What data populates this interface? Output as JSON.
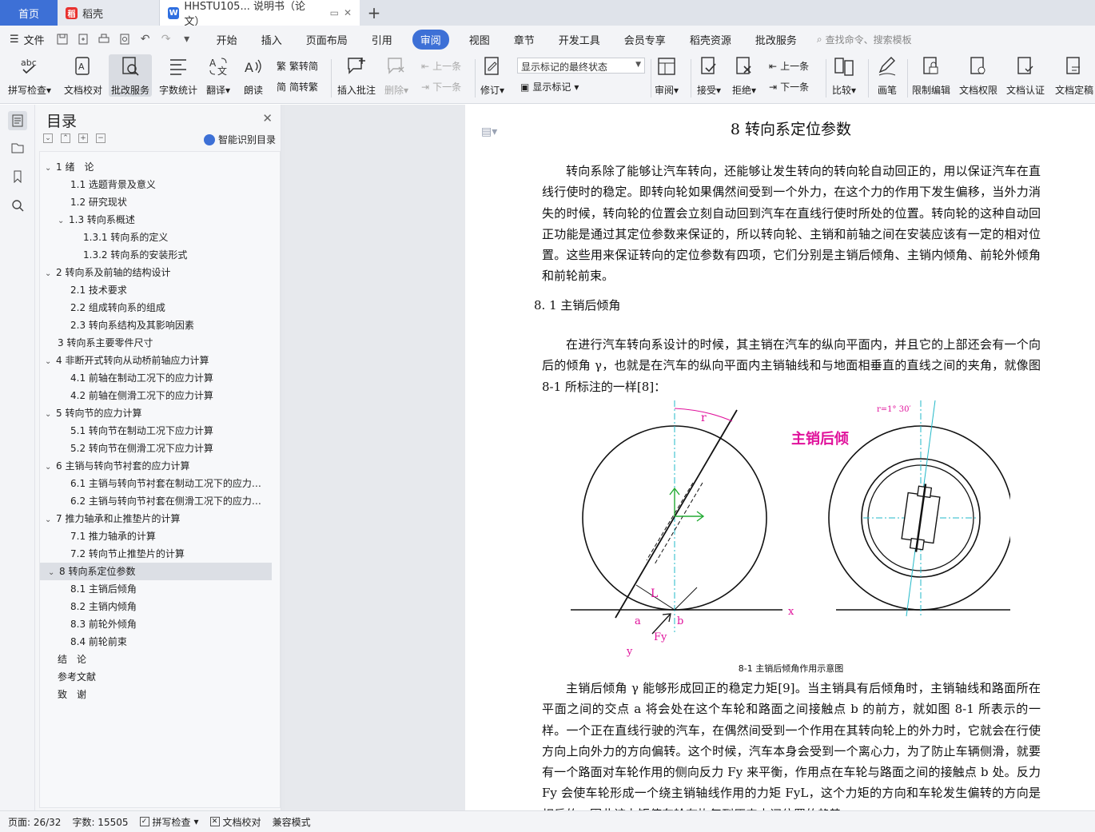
{
  "tabs": {
    "home": "首页",
    "docer": "稻壳",
    "doc": "HHSTU105... 说明书（论文）"
  },
  "menu": {
    "file": "文件",
    "tabs": [
      "开始",
      "插入",
      "页面布局",
      "引用",
      "审阅",
      "视图",
      "章节",
      "开发工具",
      "会员专享",
      "稻壳资源",
      "批改服务"
    ],
    "active_tab": "审阅",
    "search": "查找命令、搜索模板"
  },
  "toolbar": {
    "spellcheck": "拼写检查",
    "doccheck": "文档校对",
    "review_service": "批改服务",
    "wordcount": "字数统计",
    "translate": "翻译",
    "readaloud": "朗读",
    "trad": "繁转简",
    "simp": "简转繁",
    "insert_comment": "插入批注",
    "delete": "删除",
    "prev_comment": "上一条",
    "next_comment": "下一条",
    "revise": "修订",
    "markup_mode": "显示标记的最终状态",
    "show_markup": "显示标记",
    "review_pane": "审阅",
    "accept": "接受",
    "reject": "拒绝",
    "prev_change": "上一条",
    "next_change": "下一条",
    "compare": "比较",
    "pen": "画笔",
    "restrict": "限制编辑",
    "doc_permission": "文档权限",
    "doc_cert": "文档认证",
    "doc_final": "文档定稿"
  },
  "toc": {
    "title": "目录",
    "smart": "智能识别目录",
    "items": [
      "1 绪　论",
      "1.1 选题背景及意义",
      "1.2 研究现状",
      "1.3 转向系概述",
      "1.3.1 转向系的定义",
      "1.3.2 转向系的安装形式",
      "2  转向系及前轴的结构设计",
      "2.1  技术要求",
      "2.2  组成转向系的组成",
      "2.3  转向系结构及其影响因素",
      "3  转向系主要零件尺寸",
      "4 非断开式转向从动桥前轴应力计算",
      "4.1 前轴在制动工况下的应力计算",
      "4.2 前轴在侧滑工况下的应力计算",
      "5  转向节的应力计算",
      "5.1 转向节在制动工况下应力计算",
      "5.2  转向节在侧滑工况下应力计算",
      "6 主销与转向节衬套的应力计算",
      "6.1 主销与转向节衬套在制动工况下的应力…",
      "6.2 主销与转向节衬套在侧滑工况下的应力…",
      "7  推力轴承和止推垫片的计算",
      "7.1 推力轴承的计算",
      "7.2  转向节止推垫片的计算",
      "8 转向系定位参数",
      "8.1  主销后倾角",
      "8.2  主销内倾角",
      "8.3  前轮外倾角",
      "8.4  前轮前束",
      "结　论",
      "参考文献",
      "致　谢"
    ],
    "selected": 23
  },
  "doc": {
    "heading": "8  转向系定位参数",
    "p1": "转向系除了能够让汽车转向，还能够让发生转向的转向轮自动回正的，用以保证汽车在直线行使时的稳定。即转向轮如果偶然间受到一个外力，在这个力的作用下发生偏移，当外力消失的时候，转向轮的位置会立刻自动回到汽车在直线行使时所处的位置。转向轮的这种自动回正功能是通过其定位参数来保证的，所以转向轮、主销和前轴之间在安装应该有一定的相对位置。这些用来保证转向的定位参数有四项，它们分别是主销后倾角、主销内倾角、前轮外倾角和前轮前束。",
    "sub_heading": "8. 1    主销后倾角",
    "p2": "在进行汽车转向系设计的时候，其主销在汽车的纵向平面内，并且它的上部还会有一个向后的倾角 γ，也就是在汽车的纵向平面内主销轴线和与地面相垂直的直线之间的夹角，就像图 8-1 所标注的一样[8]：",
    "figure_labels": {
      "r": "r",
      "L": "L",
      "a": "a",
      "b": "b",
      "x": "x",
      "Fy": "Fy",
      "y": "y",
      "angle": "r=1° 30′",
      "title": "主销后倾"
    },
    "caption": "8-1  主销后倾角作用示意图",
    "p3": "主销后倾角 γ 能够形成回正的稳定力矩[9]。当主销具有后倾角时，主销轴线和路面所在平面之间的交点 a 将会处在这个车轮和路面之间接触点 b 的前方，就如图 8-1 所表示的一样。一个正在直线行驶的汽车，在偶然间受到一个作用在其转向轮上的外力时，它就会在行使方向上向外力的方向偏转。这个时候，汽车本身会受到一个离心力，为了防止车辆侧滑，就要有一个路面对车轮作用的侧向反力 Fy 来平衡，作用点在车轮与路面之间的接触点 b 处。反力 Fy 会使车轮形成一个绕主销轴线作用的力矩 FyL，这个力矩的方向和车轮发生偏转的方向是相反的，因此该力矩使车轮有恢复到原来中间位置的趋势。"
  },
  "status": {
    "page": "页面: 26/32",
    "words": "字数: 15505",
    "spell": "拼写检查",
    "proof": "文档校对",
    "compat": "兼容模式"
  },
  "colors": {
    "accent": "#3d70d6",
    "magenta": "#e0119b",
    "green": "#22aa33",
    "cyan": "#22b8c8"
  }
}
